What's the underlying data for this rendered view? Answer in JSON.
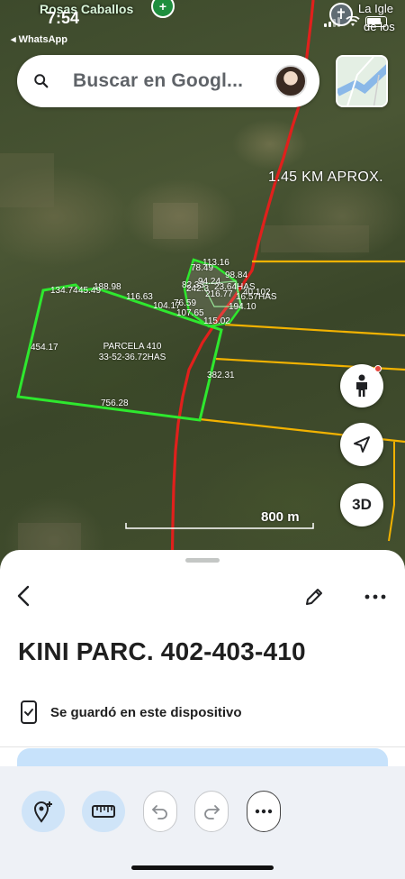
{
  "status_bar": {
    "time": "7:54",
    "back_app": "◂ WhatsApp"
  },
  "map": {
    "top_left_place": "Rosas Caballos",
    "top_right_place_line1": "La Igle",
    "top_right_place_line2": "de los",
    "distance_label": "1.45 KM APROX.",
    "parcel_name": "PARCELA 410",
    "parcel_area": "33-52-36.72HAS",
    "side_lengths": {
      "left": "454.17",
      "bottom": "756.28",
      "right": "382.31",
      "top_1": "134.74",
      "top_2": "45.49",
      "top_3": "188.98",
      "top_4": "116.63",
      "top_5": "104.17",
      "upper_1": "113.16",
      "upper_2": "78.49",
      "upper_3": "98.84",
      "small_1": "76.59",
      "small_2": "107.65",
      "small_3": "194.10",
      "small_4": "115.02"
    },
    "cluster_labels": {
      "c1": "82.33",
      "c2": "216.77",
      "c3": "242.3",
      "c4": "94.24",
      "c5": "40.102",
      "c6": "23.64HAS",
      "c7": "16.57HAS"
    },
    "scale_label": "800 m",
    "fab_3d": "3D",
    "colors": {
      "parcel_outline": "#2ee82e",
      "road_red": "#e0201c",
      "boundary_yellow": "#f2b200"
    }
  },
  "search": {
    "placeholder": "Buscar en Googl..."
  },
  "sheet": {
    "title": "KINI PARC. 402-403-410",
    "saved_text": "Se guardó en este dispositivo"
  },
  "icons": {
    "search": "search-icon",
    "layers": "layers-icon",
    "pegman": "street-view-icon",
    "location": "location-arrow-icon",
    "back": "back-chevron-icon",
    "edit": "pencil-icon",
    "more": "more-horizontal-icon",
    "add_place": "add-place-icon",
    "measure": "ruler-icon",
    "undo": "undo-icon",
    "redo": "redo-icon"
  }
}
